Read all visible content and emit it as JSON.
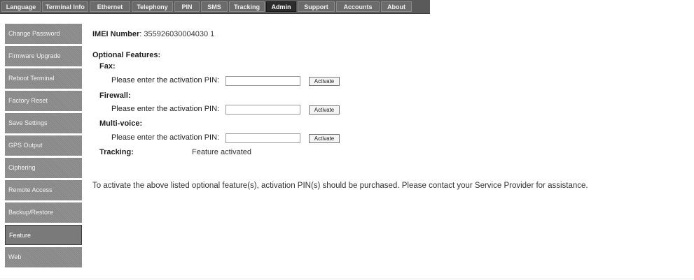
{
  "nav": {
    "tabs": [
      {
        "label": "Language"
      },
      {
        "label": "Terminal Info"
      },
      {
        "label": "Ethernet"
      },
      {
        "label": "Telephony"
      },
      {
        "label": "PIN"
      },
      {
        "label": "SMS"
      },
      {
        "label": "Tracking"
      },
      {
        "label": "Admin",
        "active": true
      },
      {
        "label": "Support"
      },
      {
        "label": "Accounts"
      },
      {
        "label": "About"
      }
    ]
  },
  "sidebar": {
    "items": [
      {
        "label": "Change Password"
      },
      {
        "label": "Firmware Upgrade"
      },
      {
        "label": "Reboot Terminal"
      },
      {
        "label": "Factory Reset"
      },
      {
        "label": "Save Settings"
      },
      {
        "label": "GPS Output"
      },
      {
        "label": "Ciphering"
      },
      {
        "label": "Remote Access"
      },
      {
        "label": "Backup/Restore"
      },
      {
        "label": "Feature",
        "active": true
      },
      {
        "label": "Web"
      }
    ]
  },
  "main": {
    "imei_label": "IMEI Number",
    "imei_colon": ":",
    "imei_value": "355926030004030 1",
    "optional_heading": "Optional Features:",
    "features": [
      {
        "name": "Fax:",
        "prompt": "Please enter the activation PIN:",
        "pin_value": "",
        "button": "Activate"
      },
      {
        "name": "Firewall:",
        "prompt": "Please enter the activation PIN:",
        "pin_value": "",
        "button": "Activate"
      },
      {
        "name": "Multi-voice:",
        "prompt": "Please enter the activation PIN:",
        "pin_value": "",
        "button": "Activate"
      }
    ],
    "tracking_label": "Tracking:",
    "tracking_status": "Feature activated",
    "notice": "To activate the above listed optional feature(s), activation PIN(s) should be purchased. Please contact your Service Provider for assistance."
  },
  "colors": {
    "nav_background": "#5a5a5a",
    "nav_active": "#2c2c2c",
    "sidebar_item": "#8c8c8c",
    "sidebar_active_border": "#3a3a3a"
  }
}
